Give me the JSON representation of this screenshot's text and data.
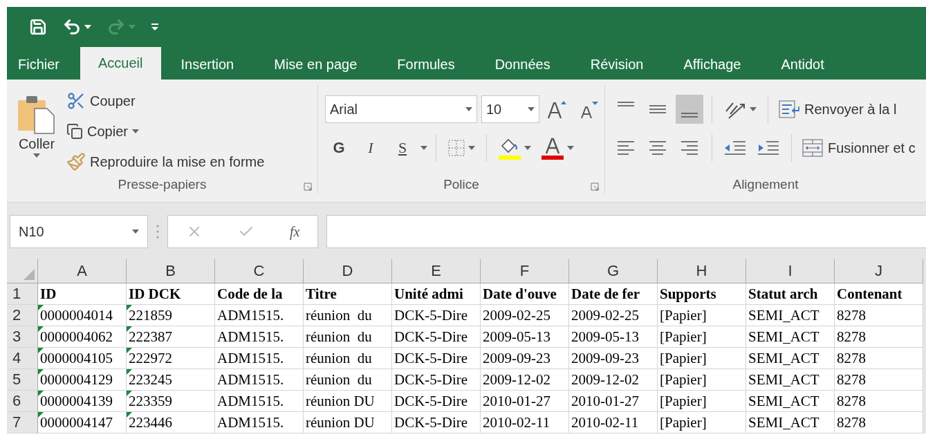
{
  "quick_access": {
    "redo": {
      "disabled": true
    }
  },
  "tabs": [
    {
      "label": "Fichier",
      "selected": false
    },
    {
      "label": "Accueil",
      "selected": true
    },
    {
      "label": "Insertion",
      "selected": false
    },
    {
      "label": "Mise en page",
      "selected": false
    },
    {
      "label": "Formules",
      "selected": false
    },
    {
      "label": "Données",
      "selected": false
    },
    {
      "label": "Révision",
      "selected": false
    },
    {
      "label": "Affichage",
      "selected": false
    },
    {
      "label": "Antidot",
      "selected": false
    }
  ],
  "clipboard": {
    "paste": "Coller",
    "cut": "Couper",
    "copy": "Copier",
    "format_painter": "Reproduire la mise en forme",
    "group_label": "Presse-papiers"
  },
  "font": {
    "name": "Arial",
    "size": "10",
    "bold": "G",
    "italic": "I",
    "underline": "S",
    "group_label": "Police"
  },
  "alignment": {
    "vertical": [
      {
        "kind": "top",
        "selected": false
      },
      {
        "kind": "middle",
        "selected": false
      },
      {
        "kind": "bottom",
        "selected": true
      }
    ],
    "wrap_text": "Renvoyer à la l",
    "merge": "Fusionner et c",
    "group_label": "Alignement"
  },
  "formula_bar": {
    "name_box": "N10",
    "function_label": "fx"
  },
  "sheet": {
    "columns": [
      "A",
      "B",
      "C",
      "D",
      "E",
      "F",
      "G",
      "H",
      "I",
      "J"
    ],
    "rows": [
      {
        "number": "1",
        "kind": "header",
        "cells": [
          {
            "text": "ID",
            "flagged": false
          },
          {
            "text": "ID DCK",
            "flagged": false
          },
          {
            "text": "Code de la",
            "flagged": false
          },
          {
            "text": "Titre",
            "flagged": false
          },
          {
            "text": "Unité admi",
            "flagged": false
          },
          {
            "text": "Date d'ouve",
            "flagged": false
          },
          {
            "text": "Date de fer",
            "flagged": false
          },
          {
            "text": "Supports",
            "flagged": false
          },
          {
            "text": "Statut arch",
            "flagged": false
          },
          {
            "text": "Contenant",
            "flagged": false
          }
        ]
      },
      {
        "number": "2",
        "kind": "data",
        "cells": [
          {
            "text": "0000004014",
            "flagged": true
          },
          {
            "text": "221859",
            "flagged": true
          },
          {
            "text": "ADM1515.",
            "flagged": false
          },
          {
            "text": "réunion  du",
            "flagged": false
          },
          {
            "text": "DCK-5-Dire",
            "flagged": false
          },
          {
            "text": "2009-02-25",
            "flagged": false
          },
          {
            "text": "2009-02-25",
            "flagged": false
          },
          {
            "text": "[Papier]",
            "flagged": false
          },
          {
            "text": "SEMI_ACT",
            "flagged": false
          },
          {
            "text": "8278",
            "flagged": false
          }
        ]
      },
      {
        "number": "3",
        "kind": "data",
        "cells": [
          {
            "text": "0000004062",
            "flagged": true
          },
          {
            "text": "222387",
            "flagged": true
          },
          {
            "text": "ADM1515.",
            "flagged": false
          },
          {
            "text": "réunion  du",
            "flagged": false
          },
          {
            "text": "DCK-5-Dire",
            "flagged": false
          },
          {
            "text": "2009-05-13",
            "flagged": false
          },
          {
            "text": "2009-05-13",
            "flagged": false
          },
          {
            "text": "[Papier]",
            "flagged": false
          },
          {
            "text": "SEMI_ACT",
            "flagged": false
          },
          {
            "text": "8278",
            "flagged": false
          }
        ]
      },
      {
        "number": "4",
        "kind": "data",
        "cells": [
          {
            "text": "0000004105",
            "flagged": true
          },
          {
            "text": "222972",
            "flagged": true
          },
          {
            "text": "ADM1515.",
            "flagged": false
          },
          {
            "text": "réunion  du",
            "flagged": false
          },
          {
            "text": "DCK-5-Dire",
            "flagged": false
          },
          {
            "text": "2009-09-23",
            "flagged": false
          },
          {
            "text": "2009-09-23",
            "flagged": false
          },
          {
            "text": "[Papier]",
            "flagged": false
          },
          {
            "text": "SEMI_ACT",
            "flagged": false
          },
          {
            "text": "8278",
            "flagged": false
          }
        ]
      },
      {
        "number": "5",
        "kind": "data",
        "cells": [
          {
            "text": "0000004129",
            "flagged": true
          },
          {
            "text": "223245",
            "flagged": true
          },
          {
            "text": "ADM1515.",
            "flagged": false
          },
          {
            "text": "réunion  du",
            "flagged": false
          },
          {
            "text": "DCK-5-Dire",
            "flagged": false
          },
          {
            "text": "2009-12-02",
            "flagged": false
          },
          {
            "text": "2009-12-02",
            "flagged": false
          },
          {
            "text": "[Papier]",
            "flagged": false
          },
          {
            "text": "SEMI_ACT",
            "flagged": false
          },
          {
            "text": "8278",
            "flagged": false
          }
        ]
      },
      {
        "number": "6",
        "kind": "data",
        "cells": [
          {
            "text": "0000004139",
            "flagged": true
          },
          {
            "text": "223359",
            "flagged": true
          },
          {
            "text": "ADM1515.",
            "flagged": false
          },
          {
            "text": "réunion DU",
            "flagged": false
          },
          {
            "text": "DCK-5-Dire",
            "flagged": false
          },
          {
            "text": "2010-01-27",
            "flagged": false
          },
          {
            "text": "2010-01-27",
            "flagged": false
          },
          {
            "text": "[Papier]",
            "flagged": false
          },
          {
            "text": "SEMI_ACT",
            "flagged": false
          },
          {
            "text": "8278",
            "flagged": false
          }
        ]
      },
      {
        "number": "7",
        "kind": "data",
        "cells": [
          {
            "text": "0000004147",
            "flagged": true
          },
          {
            "text": "223446",
            "flagged": true
          },
          {
            "text": "ADM1515.",
            "flagged": false
          },
          {
            "text": "réunion DU",
            "flagged": false
          },
          {
            "text": "DCK-5-Dire",
            "flagged": false
          },
          {
            "text": "2010-02-11",
            "flagged": false
          },
          {
            "text": "2010-02-11",
            "flagged": false
          },
          {
            "text": "[Papier]",
            "flagged": false
          },
          {
            "text": "SEMI_ACT",
            "flagged": false
          },
          {
            "text": "8278",
            "flagged": false
          }
        ]
      }
    ]
  }
}
